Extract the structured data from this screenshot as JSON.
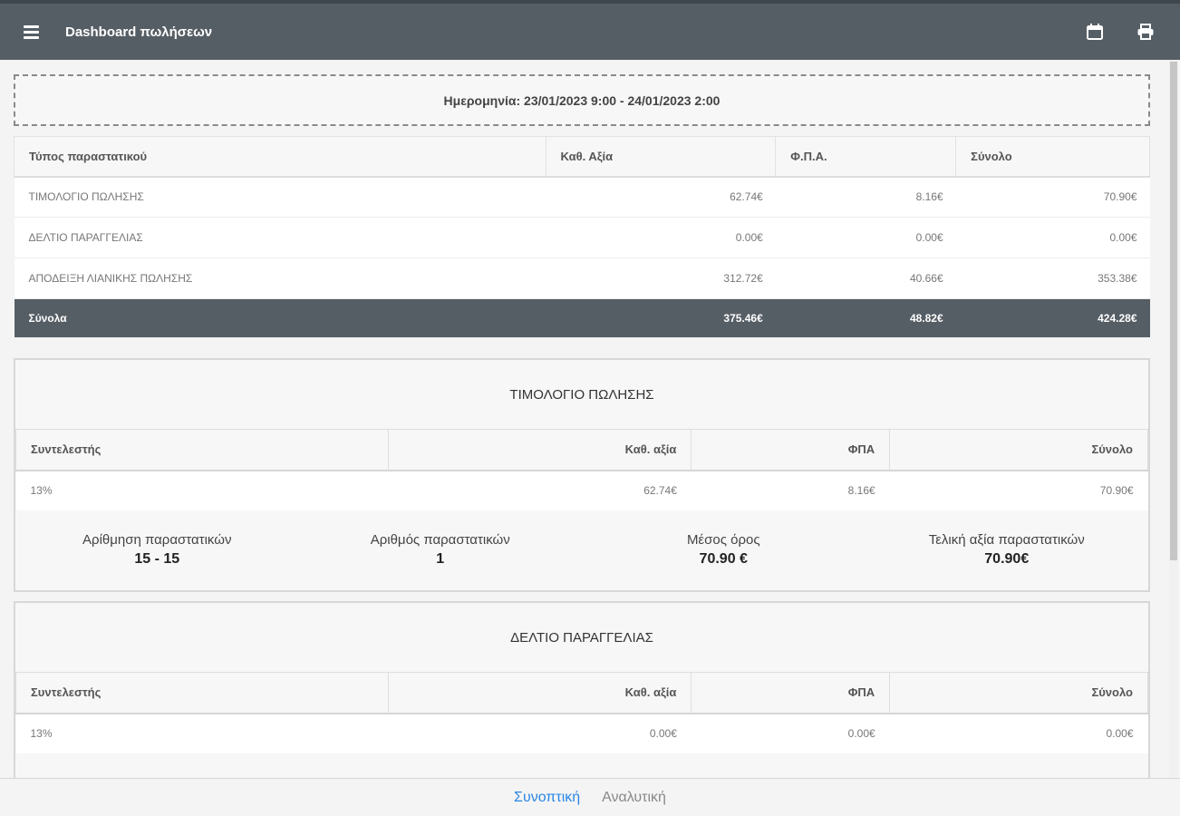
{
  "header": {
    "title": "Dashboard πωλήσεων"
  },
  "icons": {
    "menu": "menu-icon",
    "calendar": "calendar-icon",
    "print": "print-icon"
  },
  "date_range": "Ημερομηνία: 23/01/2023 9:00 - 24/01/2023 2:00",
  "summary": {
    "headers": [
      "Τύπος παραστατικού",
      "Καθ. Αξία",
      "Φ.Π.Α.",
      "Σύνολο"
    ],
    "rows": [
      [
        "ΤΙΜΟΛΟΓΙΟ ΠΩΛΗΣΗΣ",
        "62.74€",
        "8.16€",
        "70.90€"
      ],
      [
        "ΔΕΛΤΙΟ ΠΑΡΑΓΓΕΛΙΑΣ",
        "0.00€",
        "0.00€",
        "0.00€"
      ],
      [
        "ΑΠΟΔΕΙΞΗ ΛΙΑΝΙΚΗΣ ΠΩΛΗΣΗΣ",
        "312.72€",
        "40.66€",
        "353.38€"
      ]
    ],
    "total": [
      "Σύνολα",
      "375.46€",
      "48.82€",
      "424.28€"
    ]
  },
  "cards": [
    {
      "title": "ΤΙΜΟΛΟΓΙΟ ΠΩΛΗΣΗΣ",
      "headers": [
        "Συντελεστής",
        "Καθ. αξία",
        "ΦΠΑ",
        "Σύνολο"
      ],
      "row": [
        "13%",
        "62.74€",
        "8.16€",
        "70.90€"
      ],
      "stats": [
        {
          "label": "Αρίθμηση παραστατικών",
          "value": "15 - 15"
        },
        {
          "label": "Αριθμός παραστατικών",
          "value": "1"
        },
        {
          "label": "Μέσος όρος",
          "value": "70.90 €"
        },
        {
          "label": "Τελική αξία παραστατικών",
          "value": "70.90€"
        }
      ]
    },
    {
      "title": "ΔΕΛΤΙΟ ΠΑΡΑΓΓΕΛΙΑΣ",
      "headers": [
        "Συντελεστής",
        "Καθ. αξία",
        "ΦΠΑ",
        "Σύνολο"
      ],
      "row": [
        "13%",
        "0.00€",
        "0.00€",
        "0.00€"
      ]
    }
  ],
  "bottom_tabs": [
    {
      "label": "Συνοπτική",
      "active": true
    },
    {
      "label": "Αναλυτική",
      "active": false
    }
  ]
}
